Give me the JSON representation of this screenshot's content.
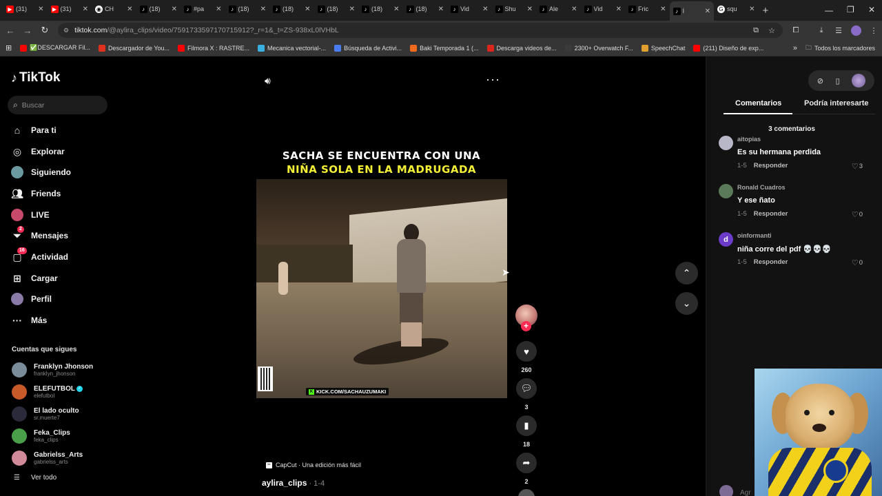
{
  "browser": {
    "tabs": [
      {
        "icon": "youtube-icon",
        "label": "(31)"
      },
      {
        "icon": "youtube-icon",
        "label": "(31)"
      },
      {
        "icon": "chrome-icon",
        "label": "CH"
      },
      {
        "icon": "tiktok-icon",
        "label": "(18)"
      },
      {
        "icon": "tiktok-icon",
        "label": "#pa"
      },
      {
        "icon": "tiktok-icon",
        "label": "(18)"
      },
      {
        "icon": "tiktok-icon",
        "label": "(18)"
      },
      {
        "icon": "tiktok-icon",
        "label": "(18)"
      },
      {
        "icon": "tiktok-icon",
        "label": "(18)"
      },
      {
        "icon": "tiktok-icon",
        "label": "(18)"
      },
      {
        "icon": "tiktok-icon",
        "label": "Vid"
      },
      {
        "icon": "tiktok-icon",
        "label": "Shu"
      },
      {
        "icon": "tiktok-icon",
        "label": "Ale"
      },
      {
        "icon": "tiktok-icon",
        "label": "Vid"
      },
      {
        "icon": "tiktok-icon",
        "label": "Fric"
      },
      {
        "icon": "tiktok-icon",
        "label": "I"
      },
      {
        "icon": "google-icon",
        "label": "squ"
      }
    ],
    "url_host": "tiktok.com",
    "url_path": "/@aylira_clips/video/7591733597170715912?_r=1&_t=ZS-938xL0lVHbL",
    "bookmarks": [
      {
        "label": "✅DESCARGAR Fil...",
        "color": "#ff0000"
      },
      {
        "label": "Descargador de You...",
        "color": "#e0301e"
      },
      {
        "label": "Filmora X : RASTRE...",
        "color": "#ff0000"
      },
      {
        "label": "Mecanica vectorial-...",
        "color": "#3ab0e0"
      },
      {
        "label": "Búsqueda de Activi...",
        "color": "#4a7cf0"
      },
      {
        "label": "Baki Temporada 1 (...",
        "color": "#f06a1e"
      },
      {
        "label": "Descarga videos de...",
        "color": "#d8261d"
      },
      {
        "label": "2300+ Overwatch F...",
        "color": "#3a3a3a"
      },
      {
        "label": "SpeechChat",
        "color": "#e0a030"
      },
      {
        "label": "(211) Diseño de exp...",
        "color": "#ff0000"
      }
    ],
    "all_bookmarks": "Todos los marcadores"
  },
  "tiktok": {
    "logo": "TikTok",
    "search_placeholder": "Buscar",
    "nav": [
      {
        "label": "Para ti",
        "icon": "home-icon"
      },
      {
        "label": "Explorar",
        "icon": "compass-icon"
      },
      {
        "label": "Siguiendo",
        "icon": "following-avatar-icon"
      },
      {
        "label": "Friends",
        "icon": "friends-icon"
      },
      {
        "label": "LIVE",
        "icon": "live-icon"
      },
      {
        "label": "Mensajes",
        "icon": "messages-icon",
        "badge": "2"
      },
      {
        "label": "Actividad",
        "icon": "activity-icon",
        "badge": "16"
      },
      {
        "label": "Cargar",
        "icon": "upload-icon"
      },
      {
        "label": "Perfil",
        "icon": "profile-avatar-icon"
      },
      {
        "label": "Más",
        "icon": "more-icon"
      }
    ],
    "following_title": "Cuentas que sigues",
    "following": [
      {
        "name": "Franklyn Jhonson",
        "user": "franklyn_jhonson",
        "verified": false,
        "color": "#7a8b9a"
      },
      {
        "name": "ELEFUTBOL",
        "user": "elefutbol",
        "verified": true,
        "color": "#c85a2a"
      },
      {
        "name": "El lado oculto",
        "user": "sr.muerte7",
        "verified": false,
        "color": "#2a2a3a"
      },
      {
        "name": "Feka_Clips",
        "user": "feka_clips",
        "verified": false,
        "color": "#4aa04a"
      },
      {
        "name": "Gabrielss_Arts",
        "user": "gabrielss_arts",
        "verified": false,
        "color": "#d08a9a"
      }
    ],
    "ver_todo": "Ver todo",
    "video": {
      "caption_line1": "SACHA SE ENCUENTRA CON UNA",
      "caption_line2": "NIÑA SOLA EN LA MADRUGADA",
      "watermark": "KICK.COM/SACHAUZUMAKI",
      "capcut": "CapCut · Una edición más fácil",
      "author": "aylira_clips",
      "date": " · 1-4"
    },
    "stats": {
      "likes": "260",
      "comments": "3",
      "saves": "18",
      "shares": "2"
    },
    "panel": {
      "tab_comments": "Comentarios",
      "tab_interest": "Podría interesarte",
      "comment_count": "3 comentarios",
      "comments": [
        {
          "user": "aitopias",
          "text": "Es su hermana perdida",
          "date": "1-5",
          "reply": "Responder",
          "likes": "3",
          "color": "#b7b7c7"
        },
        {
          "user": "Ronald Cuadros",
          "text": "Y ese ñato",
          "date": "1-5",
          "reply": "Responder",
          "likes": "0",
          "color": "#5a7a5a"
        },
        {
          "user": "oinformanti",
          "text": "niña corre del pdf 💀💀💀",
          "date": "1-5",
          "reply": "Responder",
          "likes": "0",
          "color": "#6a3ac8"
        }
      ],
      "add_comment_placeholder": "Agr"
    }
  }
}
